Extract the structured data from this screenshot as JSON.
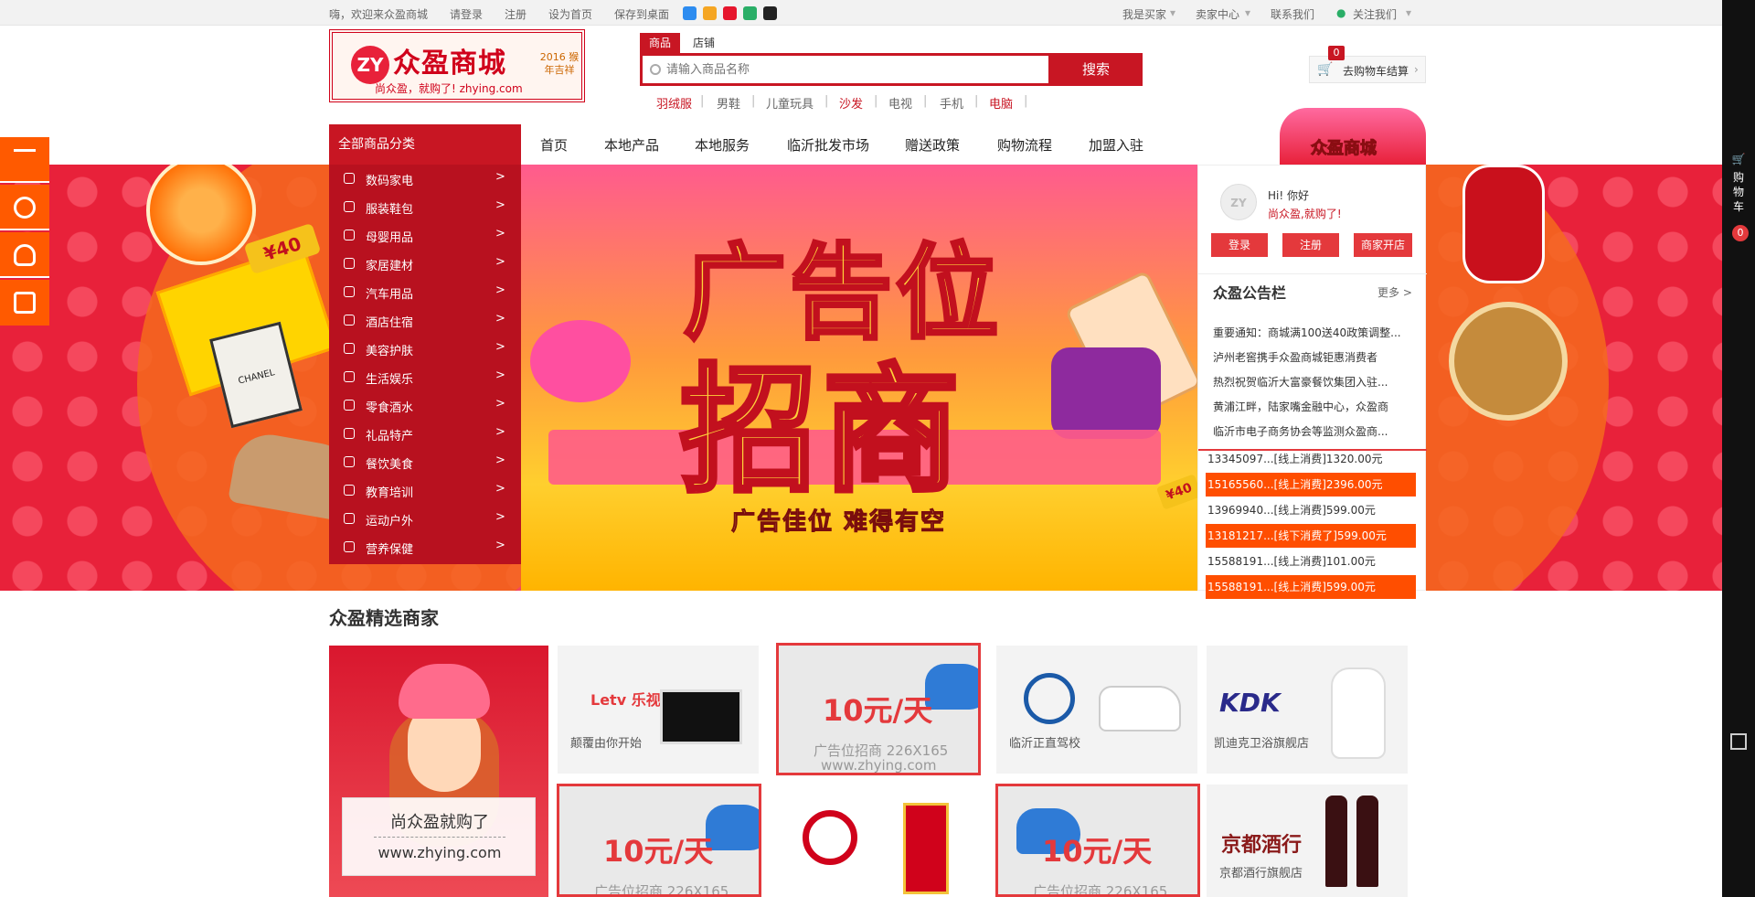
{
  "topbar": {
    "welcome": "嗨，欢迎来众盈商城",
    "login": "请登录",
    "register": "注册",
    "set_home": "设为首页",
    "save_desktop": "保存到桌面",
    "buyer": "我是买家",
    "seller": "卖家中心",
    "contact": "联系我们",
    "follow": "关注我们"
  },
  "logo": {
    "title": "众盈商城",
    "slogan": "尚众盈，就购了! zhying.com",
    "year": "2016 猴年吉祥"
  },
  "search": {
    "tab_goods": "商品",
    "tab_shop": "店铺",
    "placeholder": "请输入商品名称",
    "button": "搜索"
  },
  "hot_keywords": [
    "羽绒服",
    "男鞋",
    "儿童玩具",
    "沙发",
    "电视",
    "手机",
    "电脑"
  ],
  "cart": {
    "label": "去购物车结算",
    "count": "0"
  },
  "nav": {
    "all_categories": "全部商品分类",
    "links": [
      "首页",
      "本地产品",
      "本地服务",
      "临沂批发市场",
      "赠送政策",
      "购物流程",
      "加盟入驻"
    ]
  },
  "categories": [
    "数码家电",
    "服装鞋包",
    "母婴用品",
    "家居建材",
    "汽车用品",
    "酒店住宿",
    "美容护肤",
    "生活娱乐",
    "零食酒水",
    "礼品特产",
    "餐饮美食",
    "教育培训",
    "运动户外",
    "营养保健"
  ],
  "banner": {
    "line1": "广告位",
    "line2": "招商",
    "sub": "广告佳位 难得有空",
    "tag": "¥40",
    "perfume": "CHANEL"
  },
  "user_panel": {
    "greeting": "Hi! 你好",
    "slogan": "尚众盈,就购了!",
    "login": "登录",
    "register": "注册",
    "merchant": "商家开店",
    "notice_title": "众盈公告栏",
    "more": "更多 >",
    "notices": [
      "重要通知：商城满100送40政策调整...",
      "泸州老窖携手众盈商城钜惠消费者",
      "热烈祝贺临沂大富豪餐饮集团入驻...",
      "黄浦江畔，陆家嘴金融中心，众盈商",
      "临沂市电子商务协会等监测众盈商..."
    ],
    "transactions": [
      "13345097...[线上消费]1320.00元",
      "15165560...[线上消费]2396.00元",
      "13969940...[线上消费]599.00元",
      "13181217...[线下消费了]599.00元",
      "15588191...[线上消费]101.00元",
      "15588191...[线上消费]599.00元"
    ]
  },
  "right_sidebar": {
    "cart_label": "购物车",
    "badge": "0"
  },
  "featured": {
    "title": "众盈精选商家",
    "girl_line1": "尚众盈就购了",
    "girl_line2": "www.zhying.com",
    "letv_logo": "Letv 乐视网",
    "letv_name": "颠覆由你开始",
    "ad_price": "10元/天",
    "ad_text": "广告位招商 226X165",
    "ad_url": "www.zhying.com",
    "driving_name": "临沂正直驾校",
    "kdk_logo": "KDK",
    "kdk_name": "凯迪克卫浴旗舰店",
    "jingdu_logo": "京都酒行",
    "jingdu_name": "京都酒行旗舰店"
  }
}
